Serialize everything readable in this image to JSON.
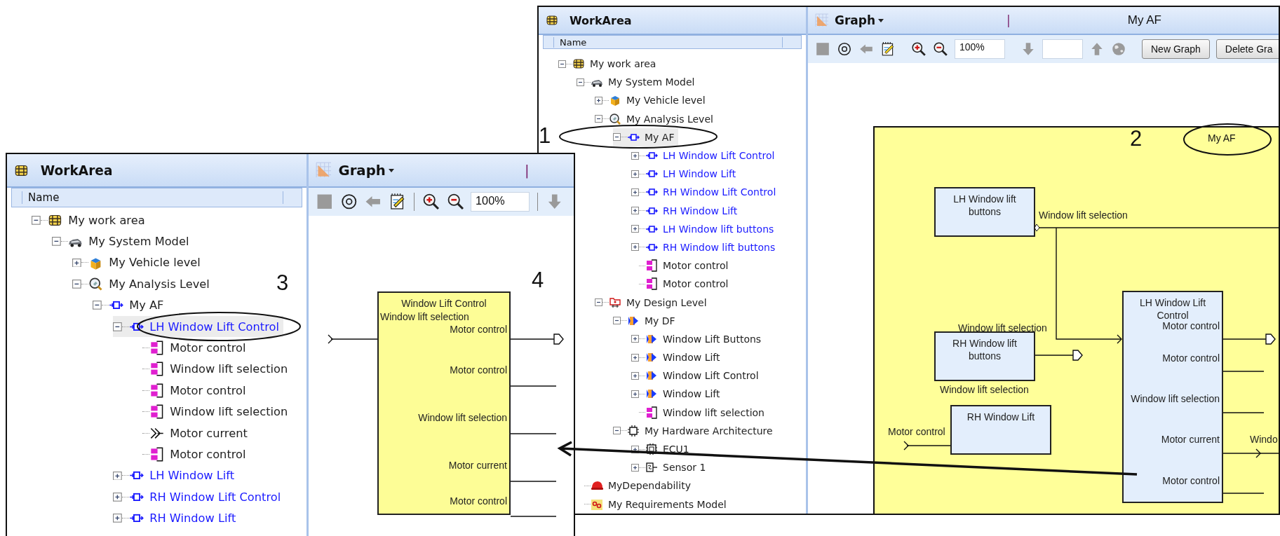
{
  "windows": [
    {
      "tree_panel": {
        "title": "WorkArea",
        "column": "Name"
      },
      "tree": [
        {
          "label": "My work area",
          "kind": "workarea",
          "expanded": true,
          "selected": false,
          "children": [
            {
              "label": "My System Model",
              "kind": "system",
              "expanded": true,
              "selected": false,
              "children": [
                {
                  "label": "My Vehicle level",
                  "kind": "vehicle",
                  "expanded": false,
                  "selected": false
                },
                {
                  "label": "My Analysis Level",
                  "kind": "analysis",
                  "expanded": true,
                  "selected": false,
                  "children": [
                    {
                      "label": "My AF",
                      "kind": "function",
                      "expanded": true,
                      "selected": true,
                      "children": [
                        {
                          "label": "LH Window Lift Control",
                          "kind": "prototype",
                          "expanded": false,
                          "selected": false
                        },
                        {
                          "label": "LH Window Lift",
                          "kind": "prototype",
                          "expanded": false,
                          "selected": false
                        },
                        {
                          "label": "RH Window Lift Control",
                          "kind": "prototype",
                          "expanded": false,
                          "selected": false
                        },
                        {
                          "label": "RH Window Lift",
                          "kind": "prototype",
                          "expanded": false,
                          "selected": false
                        },
                        {
                          "label": "LH Window lift buttons",
                          "kind": "prototype",
                          "expanded": false,
                          "selected": false
                        },
                        {
                          "label": "RH Window lift buttons",
                          "kind": "prototype",
                          "expanded": false,
                          "selected": false
                        },
                        {
                          "label": "Motor control",
                          "kind": "port",
                          "selected": false
                        },
                        {
                          "label": "Motor control",
                          "kind": "port",
                          "selected": false
                        }
                      ]
                    }
                  ]
                },
                {
                  "label": "My Design Level",
                  "kind": "design",
                  "expanded": true,
                  "selected": false,
                  "children": [
                    {
                      "label": "My DF",
                      "kind": "design-function",
                      "expanded": true,
                      "selected": false,
                      "children": [
                        {
                          "label": "Window Lift Buttons",
                          "kind": "design-prototype",
                          "expanded": false,
                          "selected": false
                        },
                        {
                          "label": "Window Lift",
                          "kind": "design-prototype",
                          "expanded": false,
                          "selected": false
                        },
                        {
                          "label": "Window Lift Control",
                          "kind": "design-prototype",
                          "expanded": false,
                          "selected": false
                        },
                        {
                          "label": "Window Lift",
                          "kind": "design-prototype",
                          "expanded": false,
                          "selected": false
                        },
                        {
                          "label": "Window lift selection",
                          "kind": "port",
                          "selected": false
                        }
                      ]
                    },
                    {
                      "label": "My Hardware Architecture",
                      "kind": "hardware",
                      "expanded": true,
                      "selected": false,
                      "children": [
                        {
                          "label": "ECU1",
                          "kind": "ecu",
                          "expanded": false,
                          "selected": false
                        },
                        {
                          "label": "Sensor 1",
                          "kind": "sensor",
                          "expanded": false,
                          "selected": false
                        }
                      ]
                    }
                  ]
                }
              ]
            },
            {
              "label": "MyDependability",
              "kind": "dependability",
              "selected": false
            },
            {
              "label": "My Requirements Model",
              "kind": "requirements",
              "selected": false
            }
          ]
        }
      ],
      "graph_panel": {
        "title": "Graph",
        "cursor": "|",
        "subtitle": "My AF",
        "toolbar": [
          {
            "kind": "stop",
            "disabled": true
          },
          {
            "kind": "target",
            "disabled": false
          },
          {
            "kind": "back",
            "disabled": true
          },
          {
            "kind": "notes",
            "disabled": false
          },
          {
            "kind": "separator"
          },
          {
            "kind": "zoom-in",
            "disabled": false
          },
          {
            "kind": "zoom-out",
            "disabled": false
          },
          {
            "kind": "field",
            "value": "100%"
          },
          {
            "kind": "separator"
          },
          {
            "kind": "down",
            "disabled": true
          },
          {
            "kind": "field"
          },
          {
            "kind": "up",
            "disabled": true
          },
          {
            "kind": "globe",
            "disabled": true
          },
          {
            "kind": "separator"
          },
          {
            "kind": "button",
            "label": "New Graph"
          },
          {
            "kind": "button",
            "label": "Delete Gra"
          }
        ],
        "diagram": {
          "frame_title": "My AF",
          "blocks": [
            {
              "title": "LH Window lift buttons",
              "kind": "prototype"
            },
            {
              "title": "RH Window lift buttons",
              "kind": "prototype"
            },
            {
              "title": "RH Window Lift",
              "kind": "prototype"
            },
            {
              "title": "LH Window Lift Control",
              "kind": "prototype"
            }
          ],
          "port_labels": [
            "Window lift selection",
            "Window lift selection",
            "Motor control",
            "Window lift selection",
            "Motor control",
            "Motor control",
            "Window lift selection",
            "Motor current",
            "Windo",
            "Motor control"
          ]
        }
      }
    },
    {
      "tree_panel": {
        "title": "WorkArea",
        "column": "Name"
      },
      "tree": [
        {
          "label": "My work area",
          "kind": "workarea",
          "expanded": true,
          "selected": false,
          "children": [
            {
              "label": "My System Model",
              "kind": "system",
              "expanded": true,
              "selected": false,
              "children": [
                {
                  "label": "My Vehicle level",
                  "kind": "vehicle",
                  "expanded": false,
                  "selected": false
                },
                {
                  "label": "My Analysis Level",
                  "kind": "analysis",
                  "expanded": true,
                  "selected": false,
                  "children": [
                    {
                      "label": "My AF",
                      "kind": "function",
                      "expanded": true,
                      "selected": false,
                      "children": [
                        {
                          "label": "LH Window Lift Control",
                          "kind": "prototype",
                          "expanded": true,
                          "selected": true,
                          "children": [
                            {
                              "label": "Motor control",
                              "kind": "port",
                              "selected": false
                            },
                            {
                              "label": "Window lift selection",
                              "kind": "port",
                              "selected": false
                            },
                            {
                              "label": "Motor control",
                              "kind": "port",
                              "selected": false
                            },
                            {
                              "label": "Window lift selection",
                              "kind": "port",
                              "selected": false
                            },
                            {
                              "label": "Motor current",
                              "kind": "flow",
                              "selected": false
                            },
                            {
                              "label": "Motor control",
                              "kind": "port",
                              "selected": false
                            }
                          ]
                        },
                        {
                          "label": "LH Window Lift",
                          "kind": "prototype",
                          "expanded": false,
                          "selected": false
                        },
                        {
                          "label": "RH Window Lift Control",
                          "kind": "prototype",
                          "expanded": false,
                          "selected": false
                        },
                        {
                          "label": "RH Window Lift",
                          "kind": "prototype",
                          "expanded": false,
                          "selected": false
                        }
                      ]
                    }
                  ]
                }
              ]
            }
          ]
        }
      ],
      "graph_panel": {
        "title": "Graph",
        "cursor": "|",
        "toolbar": [
          {
            "kind": "stop",
            "disabled": true
          },
          {
            "kind": "target",
            "disabled": false
          },
          {
            "kind": "back",
            "disabled": true
          },
          {
            "kind": "notes",
            "disabled": false
          },
          {
            "kind": "separator"
          },
          {
            "kind": "zoom-in",
            "disabled": false
          },
          {
            "kind": "zoom-out",
            "disabled": false
          },
          {
            "kind": "field",
            "value": "100%"
          },
          {
            "kind": "separator"
          },
          {
            "kind": "down",
            "disabled": true
          }
        ],
        "diagram": {
          "blocks": [
            {
              "title": "Window Lift Control",
              "kind": "function"
            }
          ],
          "port_labels": [
            "Window lift selection",
            "Motor control",
            "Motor control",
            "Window lift selection",
            "Motor current",
            "Motor control"
          ]
        }
      }
    }
  ],
  "annotations": [
    "1",
    "2",
    "3",
    "4"
  ]
}
